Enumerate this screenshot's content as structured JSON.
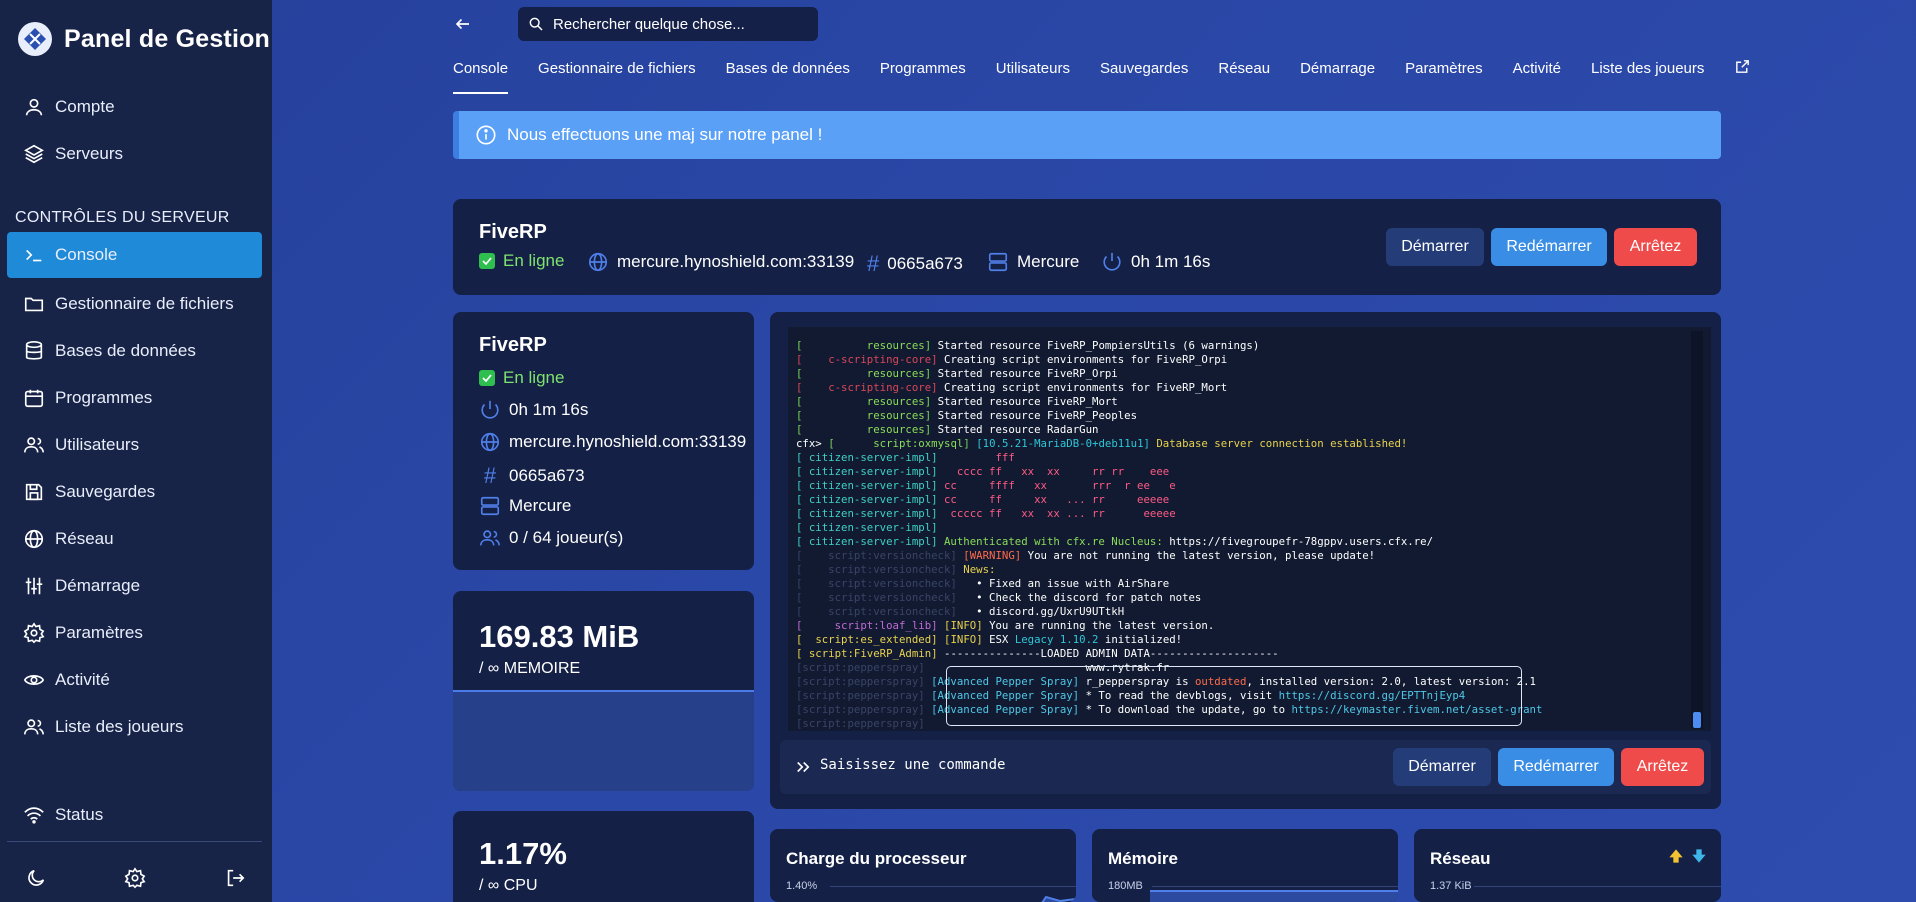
{
  "brand": {
    "title": "Panel de Gestion"
  },
  "sidebar": {
    "top_items": [
      {
        "label": "Compte",
        "icon": "user-icon"
      },
      {
        "label": "Serveurs",
        "icon": "layers-icon"
      }
    ],
    "section_label": "CONTRÔLES DU SERVEUR",
    "items": [
      {
        "label": "Console",
        "icon": "terminal-icon",
        "active": true
      },
      {
        "label": "Gestionnaire de fichiers",
        "icon": "folder-icon"
      },
      {
        "label": "Bases de données",
        "icon": "database-icon"
      },
      {
        "label": "Programmes",
        "icon": "calendar-icon"
      },
      {
        "label": "Utilisateurs",
        "icon": "users-icon"
      },
      {
        "label": "Sauvegardes",
        "icon": "save-icon"
      },
      {
        "label": "Réseau",
        "icon": "globe-icon"
      },
      {
        "label": "Démarrage",
        "icon": "sliders-icon"
      },
      {
        "label": "Paramètres",
        "icon": "gear-icon"
      },
      {
        "label": "Activité",
        "icon": "eye-icon"
      },
      {
        "label": "Liste des joueurs",
        "icon": "users-icon"
      }
    ],
    "status_label": "Status"
  },
  "search": {
    "placeholder": "Rechercher quelque chose..."
  },
  "tabs": [
    {
      "label": "Console",
      "active": true
    },
    {
      "label": "Gestionnaire de fichiers"
    },
    {
      "label": "Bases de données"
    },
    {
      "label": "Programmes"
    },
    {
      "label": "Utilisateurs"
    },
    {
      "label": "Sauvegardes"
    },
    {
      "label": "Réseau"
    },
    {
      "label": "Démarrage"
    },
    {
      "label": "Paramètres"
    },
    {
      "label": "Activité"
    },
    {
      "label": "Liste des joueurs"
    }
  ],
  "notice": {
    "text": "Nous effectuons une maj sur notre panel !"
  },
  "server": {
    "name": "FiveRP",
    "status": "En ligne",
    "address": "mercure.hynoshield.com:33139",
    "id": "0665a673",
    "node": "Mercure",
    "uptime": "0h 1m 16s",
    "players": "0 / 64 joueur(s)"
  },
  "buttons": {
    "start": "Démarrer",
    "restart": "Redémarrer",
    "stop": "Arrêtez"
  },
  "stats": {
    "memory_value": "169.83 MiB",
    "memory_label": "/ ∞ MEMOIRE",
    "cpu_value": "1.17%",
    "cpu_label": "/ ∞ CPU"
  },
  "console": {
    "command_placeholder": "Saisissez une commande",
    "lines": [
      [
        [
          "[          ",
          "c-br"
        ],
        [
          "resources",
          "c-res"
        ],
        [
          "] ",
          "c-br"
        ],
        [
          "Started resource FiveRP_PompiersUtils (6 warnings)",
          "c-white"
        ]
      ],
      [
        [
          "[    ",
          "c-red"
        ],
        [
          "c-scripting-core",
          "c-red"
        ],
        [
          "] ",
          "c-red"
        ],
        [
          "Creating script environments for FiveRP_Orpi",
          "c-white"
        ]
      ],
      [
        [
          "[          ",
          "c-br"
        ],
        [
          "resources",
          "c-res"
        ],
        [
          "] ",
          "c-br"
        ],
        [
          "Started resource FiveRP_Orpi",
          "c-white"
        ]
      ],
      [
        [
          "[    ",
          "c-red"
        ],
        [
          "c-scripting-core",
          "c-red"
        ],
        [
          "] ",
          "c-red"
        ],
        [
          "Creating script environments for FiveRP_Mort",
          "c-white"
        ]
      ],
      [
        [
          "[          ",
          "c-br"
        ],
        [
          "resources",
          "c-res"
        ],
        [
          "] ",
          "c-br"
        ],
        [
          "Started resource FiveRP_Mort",
          "c-white"
        ]
      ],
      [
        [
          "[          ",
          "c-br"
        ],
        [
          "resources",
          "c-res"
        ],
        [
          "] ",
          "c-br"
        ],
        [
          "Started resource FiveRP_Peoples",
          "c-white"
        ]
      ],
      [
        [
          "[          ",
          "c-br"
        ],
        [
          "resources",
          "c-res"
        ],
        [
          "] ",
          "c-br"
        ],
        [
          "Started resource RadarGun",
          "c-white"
        ]
      ],
      [
        [
          "cfx> ",
          "c-white"
        ],
        [
          "[      ",
          "c-br"
        ],
        [
          "script:oxmysql",
          "c-res"
        ],
        [
          "] ",
          "c-br"
        ],
        [
          "[10.5.21-MariaDB-0+deb11u1] ",
          "c-cyan"
        ],
        [
          "Database server connection established!",
          "c-yellow"
        ]
      ],
      [
        [
          "[ citizen-server-impl] ",
          "c-teal"
        ],
        [
          "        fff",
          "c-pink"
        ]
      ],
      [
        [
          "[ citizen-server-impl] ",
          "c-teal"
        ],
        [
          "  cccc ff   xx  xx     rr rr    eee",
          "c-pink"
        ]
      ],
      [
        [
          "[ citizen-server-impl] ",
          "c-teal"
        ],
        [
          "cc     ffff   xx       rrr  r ee   e",
          "c-pink"
        ]
      ],
      [
        [
          "[ citizen-server-impl] ",
          "c-teal"
        ],
        [
          "cc     ff     xx   ... rr     eeeee",
          "c-pink"
        ]
      ],
      [
        [
          "[ citizen-server-impl] ",
          "c-teal"
        ],
        [
          " ccccc ff   xx  xx ... rr      eeeee",
          "c-pink"
        ]
      ],
      [
        [
          "[ citizen-server-impl] ",
          "c-teal"
        ]
      ],
      [
        [
          "[ citizen-server-impl] ",
          "c-teal"
        ],
        [
          "Authenticated with cfx.re Nucleus: ",
          "c-res"
        ],
        [
          "https://fivegroupefr-78gppv.users.cfx.re/",
          "c-white"
        ]
      ],
      [
        [
          "[    script:versioncheck] ",
          "c-dim"
        ],
        [
          "[WARNING] ",
          "c-orange"
        ],
        [
          "You are not running the latest version, please update!",
          "c-white"
        ]
      ],
      [
        [
          "[    script:versioncheck] ",
          "c-dim"
        ],
        [
          "News:",
          "c-yellow"
        ]
      ],
      [
        [
          "[    script:versioncheck] ",
          "c-dim"
        ],
        [
          "  • Fixed an issue with AirShare",
          "c-white"
        ]
      ],
      [
        [
          "[    script:versioncheck] ",
          "c-dim"
        ],
        [
          "  • Check the discord for patch notes",
          "c-white"
        ]
      ],
      [
        [
          "[    script:versioncheck] ",
          "c-dim"
        ],
        [
          "  • discord.gg/UxrU9UTtkH",
          "c-white"
        ]
      ],
      [
        [
          "[     ",
          "c-purple"
        ],
        [
          "script:loaf_lib",
          "c-purple"
        ],
        [
          "] ",
          "c-purple"
        ],
        [
          "[INFO] ",
          "c-yellow"
        ],
        [
          "You are running the latest version.",
          "c-white"
        ]
      ],
      [
        [
          "[  ",
          "c-yellow"
        ],
        [
          "script:es_extended",
          "c-yellow"
        ],
        [
          "] ",
          "c-yellow"
        ],
        [
          "[INFO] ",
          "c-yellow"
        ],
        [
          "ESX ",
          "c-white"
        ],
        [
          "Legacy 1.10.2 ",
          "c-cyan"
        ],
        [
          "initialized!",
          "c-white"
        ]
      ],
      [
        [
          "[ ",
          "c-yellow"
        ],
        [
          "script:FiveRP_Admin",
          "c-yellow"
        ],
        [
          "] ",
          "c-yellow"
        ],
        [
          "---------------LOADED ADMIN DATA--------------------",
          "c-white"
        ]
      ],
      [
        [
          "[script:pepperspray] ",
          "c-dim"
        ],
        [
          "                        www.rytrak.fr",
          "c-white"
        ]
      ],
      [
        [
          "[script:pepperspray] ",
          "c-dim"
        ],
        [
          "[Advanced Pepper Spray] ",
          "c-link"
        ],
        [
          "r_pepperspray is ",
          "c-white"
        ],
        [
          "outdated",
          "c-orange"
        ],
        [
          ", installed version: 2.0, latest version: 2.1",
          "c-white"
        ]
      ],
      [
        [
          "[script:pepperspray] ",
          "c-dim"
        ],
        [
          "[Advanced Pepper Spray] ",
          "c-link"
        ],
        [
          "* To read the devblogs, visit ",
          "c-white"
        ],
        [
          "https://discord.gg/EPTTnjEyp4",
          "c-link"
        ]
      ],
      [
        [
          "[script:pepperspray] ",
          "c-dim"
        ],
        [
          "[Advanced Pepper Spray] ",
          "c-link"
        ],
        [
          "* To download the update, go to ",
          "c-white"
        ],
        [
          "https://keymaster.fivem.net/asset-grant",
          "c-link"
        ]
      ],
      [
        [
          "[script:pepperspray] ",
          "c-dim"
        ]
      ]
    ]
  },
  "graphs": [
    {
      "title": "Charge du processeur",
      "axis": "1.40%"
    },
    {
      "title": "Mémoire",
      "axis": "180MB"
    },
    {
      "title": "Réseau",
      "axis": "1.37 KiB"
    }
  ]
}
